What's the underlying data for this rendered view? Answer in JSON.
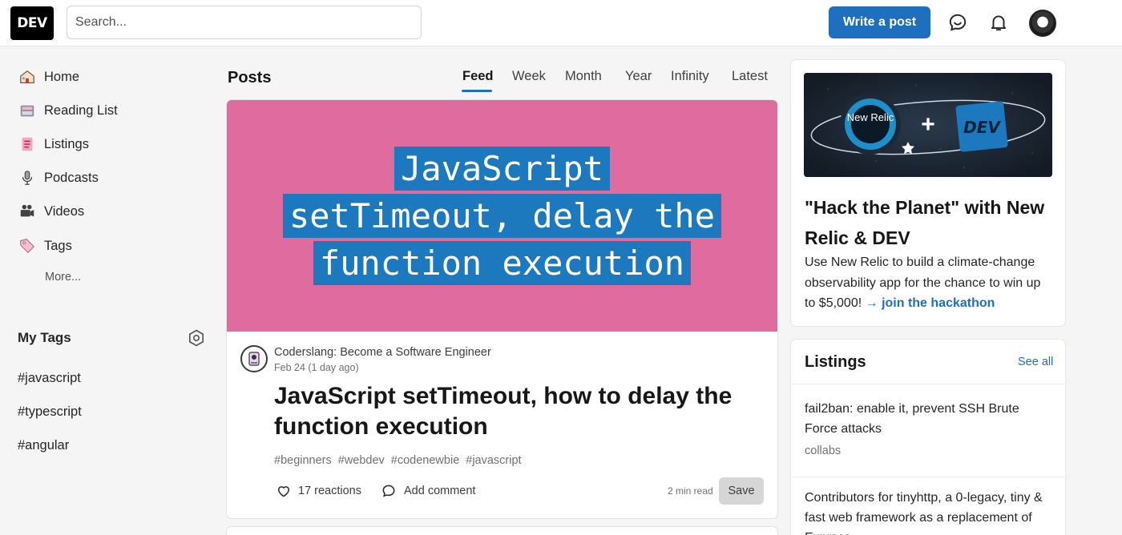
{
  "header": {
    "logo_text": "DEV",
    "search_placeholder": "Search...",
    "write_post_label": "Write a post",
    "icons": [
      "chat-icon",
      "bell-icon",
      "user-avatar"
    ]
  },
  "sidebar": {
    "items": [
      {
        "label": "Home",
        "icon": "house-icon"
      },
      {
        "label": "Reading List",
        "icon": "reading-list-icon"
      },
      {
        "label": "Listings",
        "icon": "listings-icon"
      },
      {
        "label": "Podcasts",
        "icon": "microphone-icon"
      },
      {
        "label": "Videos",
        "icon": "video-camera-icon"
      },
      {
        "label": "Tags",
        "icon": "tag-icon"
      }
    ],
    "more_label": "More...",
    "my_tags_title": "My Tags",
    "my_tags": [
      "#javascript",
      "#typescript",
      "#angular"
    ]
  },
  "feed": {
    "title": "Posts",
    "tabs": [
      "Feed",
      "Week",
      "Month",
      "Year",
      "Infinity",
      "Latest"
    ],
    "active_tab": "Feed"
  },
  "post": {
    "cover_lines": [
      "JavaScript",
      "setTimeout, delay the",
      "function execution"
    ],
    "cover_bg": "#e06c9f",
    "cover_highlight": "#1c79bd",
    "author": "Coderslang: Become a Software Engineer",
    "date": "Feb 24 (1 day ago)",
    "title": "JavaScript setTimeout, how to delay the function execution",
    "tags": [
      "#beginners",
      "#webdev",
      "#codenewbie",
      "#javascript"
    ],
    "reactions": "17 reactions",
    "comment_label": "Add comment",
    "read_time": "2 min read",
    "save_label": "Save"
  },
  "promo": {
    "title": "\"Hack the Planet\" with New Relic & DEV",
    "text": "Use New Relic to build a climate-change observability app for the chance to win up to $5,000!",
    "link_text": "→ join the hackathon",
    "badge_left": "New Relic",
    "badge_plus": "+",
    "badge_right": "DEV"
  },
  "listings": {
    "title": "Listings",
    "see_all": "See all",
    "items": [
      {
        "title": "fail2ban: enable it, prevent SSH Brute Force attacks",
        "category": "collabs"
      },
      {
        "title": "Contributors for tinyhttp, a 0-legacy, tiny & fast web framework as a replacement of Express",
        "category": ""
      }
    ]
  },
  "colors": {
    "accent": "#1f6fbf",
    "page_bg": "#f5f5f5"
  }
}
